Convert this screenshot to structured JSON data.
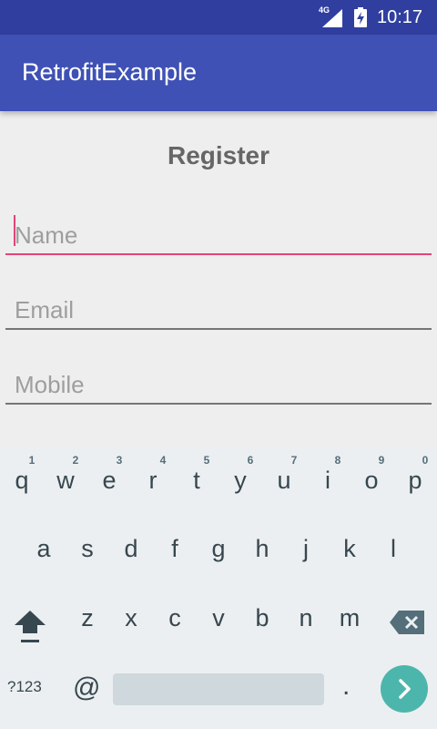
{
  "status_bar": {
    "network": "4G",
    "time": "10:17"
  },
  "app_bar": {
    "title": "RetrofitExample"
  },
  "form": {
    "heading": "Register",
    "name_placeholder": "Name",
    "email_placeholder": "Email",
    "mobile_placeholder": "Mobile"
  },
  "keyboard": {
    "row1": [
      {
        "key": "q",
        "hint": "1"
      },
      {
        "key": "w",
        "hint": "2"
      },
      {
        "key": "e",
        "hint": "3"
      },
      {
        "key": "r",
        "hint": "4"
      },
      {
        "key": "t",
        "hint": "5"
      },
      {
        "key": "y",
        "hint": "6"
      },
      {
        "key": "u",
        "hint": "7"
      },
      {
        "key": "i",
        "hint": "8"
      },
      {
        "key": "o",
        "hint": "9"
      },
      {
        "key": "p",
        "hint": "0"
      }
    ],
    "row2": [
      "a",
      "s",
      "d",
      "f",
      "g",
      "h",
      "j",
      "k",
      "l"
    ],
    "row3": [
      "z",
      "x",
      "c",
      "v",
      "b",
      "n",
      "m"
    ],
    "symbols_label": "?123",
    "at_label": "@",
    "period_label": ".",
    "icons": {
      "shift": "shift-icon",
      "backspace": "backspace-icon",
      "go": "chevron-right-icon"
    }
  },
  "colors": {
    "status_bar": "#303f9f",
    "app_bar": "#3f51b5",
    "accent": "#e0447a",
    "go_button": "#4db6ac"
  }
}
